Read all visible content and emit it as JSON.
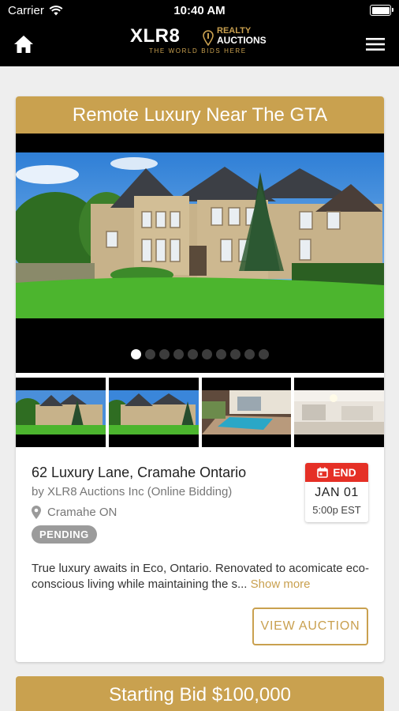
{
  "status_bar": {
    "carrier": "Carrier",
    "time": "10:40 AM"
  },
  "app_bar": {
    "logo": {
      "brand": "XLR8",
      "line1": "REALTY",
      "line2": "AUCTIONS",
      "tagline": "THE WORLD BIDS HERE"
    },
    "home_icon": "home-icon",
    "menu_icon": "hamburger-menu-icon"
  },
  "listing": {
    "title": "Remote Luxury Near The GTA",
    "gallery": {
      "total_images": 10,
      "active_index": 0
    },
    "address": "62 Luxury Lane, Cramahe Ontario",
    "seller": "by XLR8 Auctions Inc (Online Bidding)",
    "location": "Cramahe ON",
    "status": "PENDING",
    "end": {
      "label": "END",
      "date": "JAN 01",
      "time": "5:00p EST"
    },
    "description": "True luxury awaits in Eco, Ontario. Renovated to acomicate eco-conscious living while maintaining the s...",
    "show_more": "Show more",
    "view_button": "VIEW AUCTION"
  },
  "next_card": {
    "title": "Starting Bid $100,000"
  },
  "colors": {
    "gold": "#c9a14f",
    "end_red": "#e53026",
    "badge_gray": "#9b9b9b"
  }
}
